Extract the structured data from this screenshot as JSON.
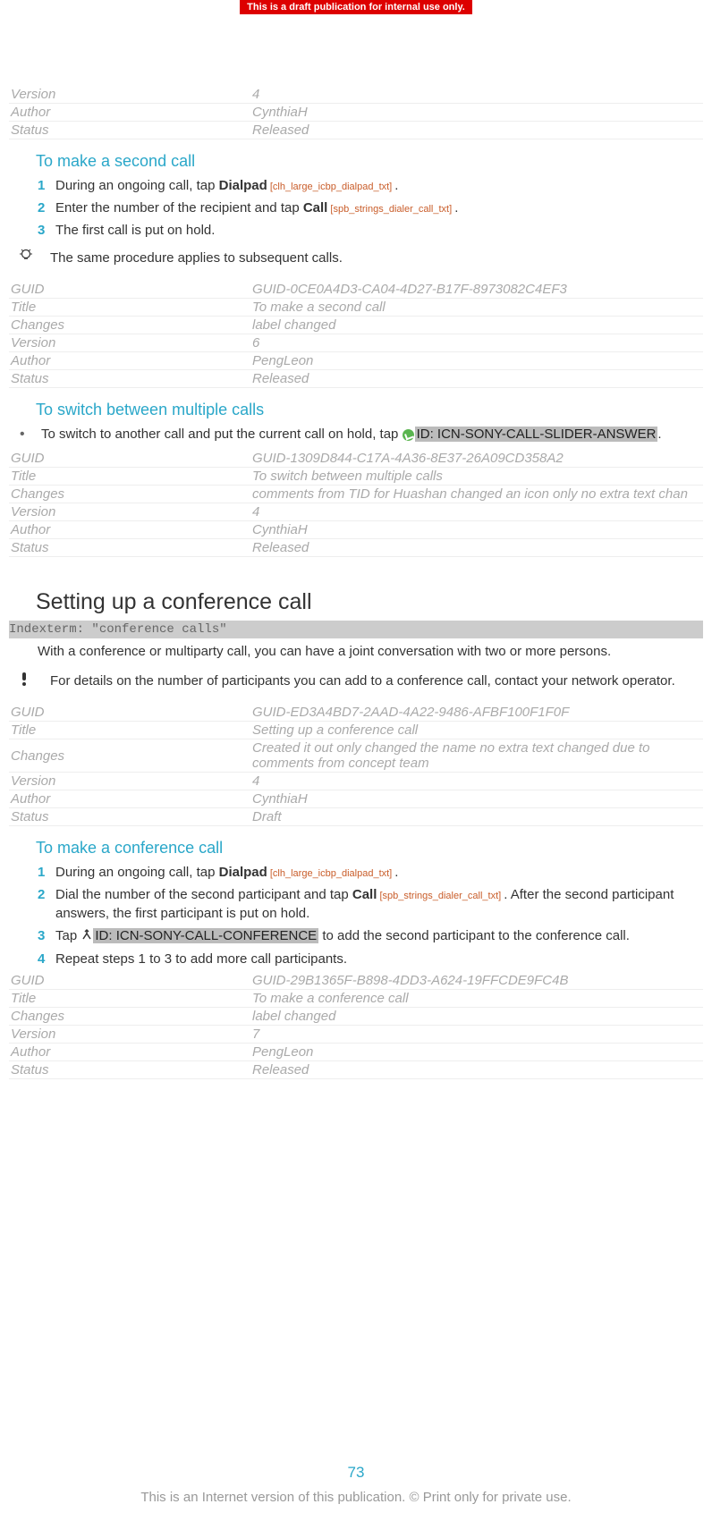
{
  "banner": "This is a draft publication for internal use only.",
  "meta1": {
    "version_label": "Version",
    "version_val": "4",
    "author_label": "Author",
    "author_val": "CynthiaH",
    "status_label": "Status",
    "status_val": "Released"
  },
  "sec_second_call": {
    "title": "To make a second call",
    "steps": [
      {
        "num": "1",
        "pre": "During an ongoing call, tap ",
        "bold": "Dialpad",
        "res": " [clh_large_icbp_dialpad_txt] ",
        "post": "."
      },
      {
        "num": "2",
        "pre": "Enter the number of the recipient and tap ",
        "bold": "Call",
        "res": " [spb_strings_dialer_call_txt] ",
        "post": "."
      },
      {
        "num": "3",
        "pre": "The first call is put on hold."
      }
    ],
    "tip": "The same procedure applies to subsequent calls."
  },
  "meta2": {
    "guid_label": "GUID",
    "guid_val": "GUID-0CE0A4D3-CA04-4D27-B17F-8973082C4EF3",
    "title_label": "Title",
    "title_val": "To make a second call",
    "changes_label": "Changes",
    "changes_val": "label changed",
    "version_label": "Version",
    "version_val": "6",
    "author_label": "Author",
    "author_val": "PengLeon",
    "status_label": "Status",
    "status_val": "Released"
  },
  "sec_switch": {
    "title": "To switch between multiple calls",
    "bullet_pre": "To switch to another call and put the current call on hold, tap ",
    "bullet_id": "ID: ICN-SONY-CALL-SLIDER-ANSWER",
    "bullet_post": "."
  },
  "meta3": {
    "guid_label": "GUID",
    "guid_val": "GUID-1309D844-C17A-4A36-8E37-26A09CD358A2",
    "title_label": "Title",
    "title_val": "To switch between multiple calls",
    "changes_label": "Changes",
    "changes_val": "comments from TID for Huashan changed an icon only no extra text chan",
    "version_label": "Version",
    "version_val": "4",
    "author_label": "Author",
    "author_val": "CynthiaH",
    "status_label": "Status",
    "status_val": "Released"
  },
  "sec_conf": {
    "title": "Setting up a conference call",
    "indexterm": "Indexterm: \"conference calls\"",
    "body": "With a conference or multiparty call, you can have a joint conversation with two or more persons.",
    "note": "For details on the number of participants you can add to a conference call, contact your network operator."
  },
  "meta4": {
    "guid_label": "GUID",
    "guid_val": "GUID-ED3A4BD7-2AAD-4A22-9486-AFBF100F1F0F",
    "title_label": "Title",
    "title_val": "Setting up a conference call",
    "changes_label": "Changes",
    "changes_val": "Created it out only changed the name no extra text changed due to comments from concept team",
    "version_label": "Version",
    "version_val": "4",
    "author_label": "Author",
    "author_val": "CynthiaH",
    "status_label": "Status",
    "status_val": "Draft"
  },
  "sec_make_conf": {
    "title": "To make a conference call",
    "steps": [
      {
        "num": "1",
        "pre": "During an ongoing call, tap ",
        "bold": "Dialpad",
        "res": " [clh_large_icbp_dialpad_txt] ",
        "post": "."
      },
      {
        "num": "2",
        "pre": "Dial the number of the second participant and tap ",
        "bold": "Call",
        "res": " [spb_strings_dialer_call_txt] ",
        "post": ". After the second participant answers, the first participant is put on hold."
      },
      {
        "num": "3",
        "pre": "Tap ",
        "icon": true,
        "id": "ID: ICN-SONY-CALL-CONFERENCE",
        "post": " to add the second participant to the conference call."
      },
      {
        "num": "4",
        "pre": "Repeat steps 1 to 3 to add more call participants."
      }
    ]
  },
  "meta5": {
    "guid_label": "GUID",
    "guid_val": "GUID-29B1365F-B898-4DD3-A624-19FFCDE9FC4B",
    "title_label": "Title",
    "title_val": "To make a conference call",
    "changes_label": "Changes",
    "changes_val": "label changed",
    "version_label": "Version",
    "version_val": "7",
    "author_label": "Author",
    "author_val": "PengLeon",
    "status_label": "Status",
    "status_val": "Released"
  },
  "page_num": "73",
  "footer": "This is an Internet version of this publication. © Print only for private use."
}
